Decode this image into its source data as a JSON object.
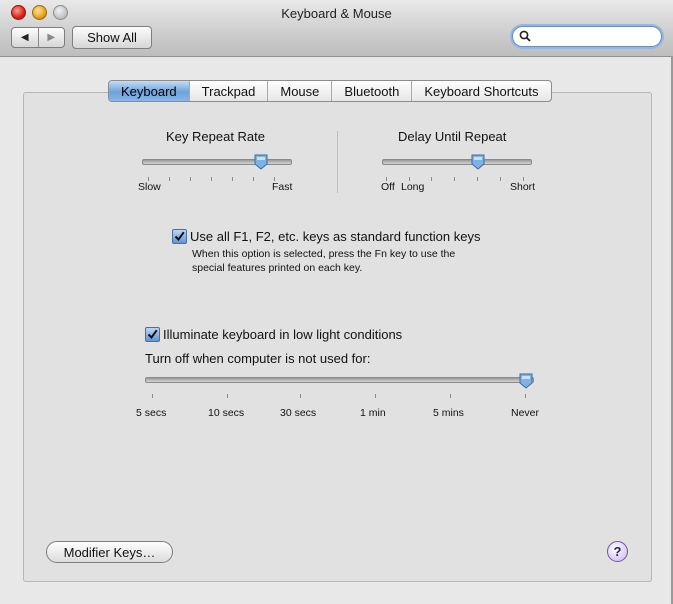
{
  "window": {
    "title": "Keyboard & Mouse",
    "nav_back": "◀",
    "nav_forward": "▶",
    "show_all": "Show All",
    "search_placeholder": ""
  },
  "tabs": [
    "Keyboard",
    "Trackpad",
    "Mouse",
    "Bluetooth",
    "Keyboard Shortcuts"
  ],
  "active_tab": "Keyboard",
  "key_repeat": {
    "title": "Key Repeat Rate",
    "min_label": "Slow",
    "max_label": "Fast",
    "value_fraction": 0.8
  },
  "delay_until_repeat": {
    "title": "Delay Until Repeat",
    "min_label": "Off",
    "min_label2": "Long",
    "max_label": "Short",
    "value_fraction": 0.65
  },
  "function_keys": {
    "label": "Use all F1, F2, etc. keys as standard function keys",
    "checked": true,
    "desc_line1": "When this option is selected, press the Fn key to use the",
    "desc_line2": "special features printed on each key."
  },
  "illuminate": {
    "label": "Illuminate keyboard in low light conditions",
    "checked": true,
    "turn_off_label": "Turn off when computer is not used for:",
    "ticks": [
      "5 secs",
      "10 secs",
      "30 secs",
      "1 min",
      "5 mins",
      "Never"
    ],
    "value": "Never"
  },
  "buttons": {
    "modifier_keys": "Modifier Keys…",
    "help": "?"
  },
  "colors": {
    "accent": "#6fa2dc",
    "window_bg": "#e8e8e8",
    "pane_bg": "#e1e1e1"
  }
}
